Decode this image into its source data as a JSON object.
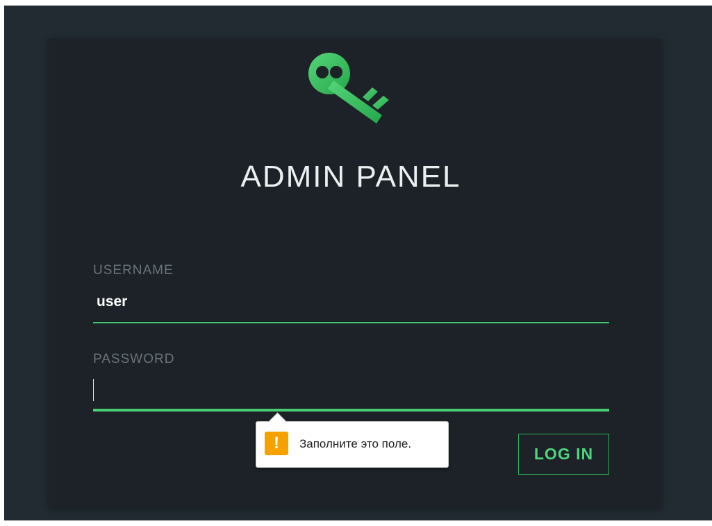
{
  "page": {
    "title": "ADMIN PANEL",
    "logo_icon": "key-icon",
    "accent_color": "#3ec46d"
  },
  "form": {
    "username": {
      "label": "USERNAME",
      "value": "user"
    },
    "password": {
      "label": "PASSWORD",
      "value": ""
    },
    "submit_label": "LOG IN"
  },
  "validation_tooltip": {
    "icon": "warning-icon",
    "icon_glyph": "!",
    "message": "Заполните это поле."
  }
}
